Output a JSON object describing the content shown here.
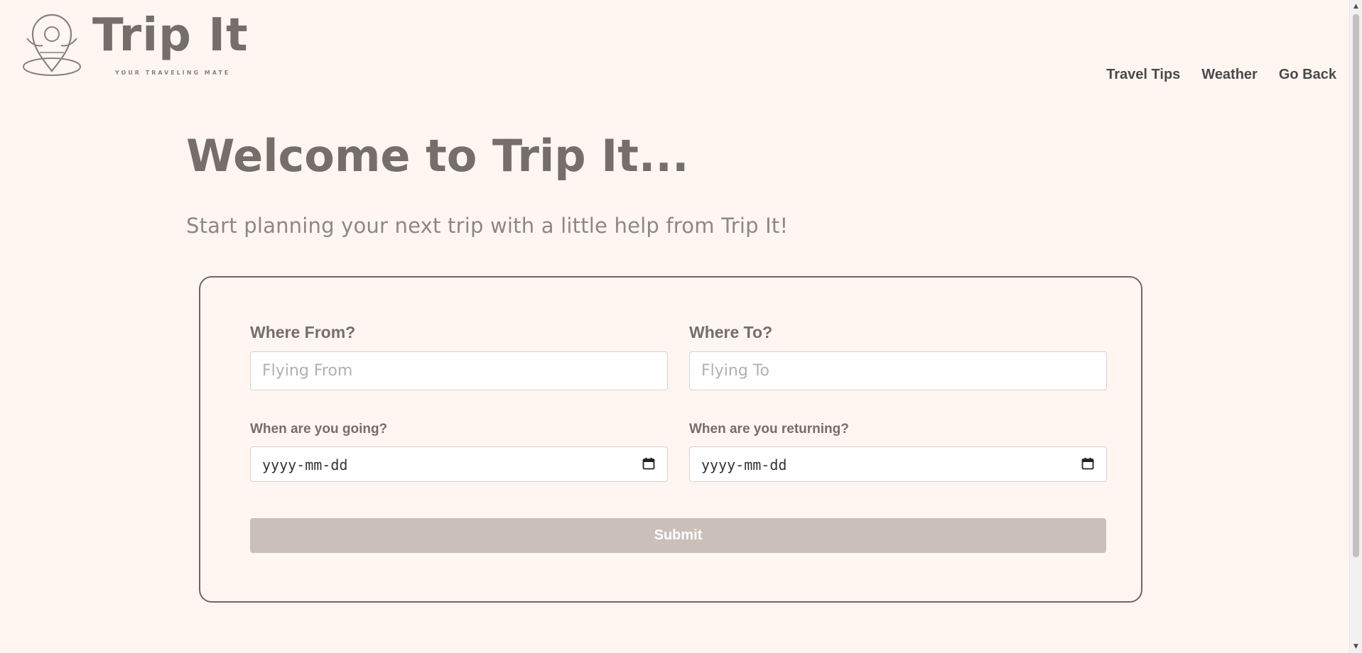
{
  "header": {
    "logo_text": "Trip It",
    "tagline": "YOUR TRAVELING MATE",
    "nav": [
      {
        "label": "Travel Tips"
      },
      {
        "label": "Weather"
      },
      {
        "label": "Go Back"
      }
    ]
  },
  "hero": {
    "title": "Welcome to Trip It...",
    "subtitle": "Start planning your next trip with a little help from Trip It!"
  },
  "form": {
    "from_label": "Where From?",
    "from_placeholder": "Flying From",
    "to_label": "Where To?",
    "to_placeholder": "Flying To",
    "depart_label": "When are you going?",
    "depart_value": "yyyy-mm-dd",
    "return_label": "When are you returning?",
    "return_value": "yyyy-mm-dd",
    "submit_label": "Submit"
  },
  "colors": {
    "background": "#fff6f2",
    "brand": "#776e6a",
    "submit_bg": "#cbbfb9"
  }
}
